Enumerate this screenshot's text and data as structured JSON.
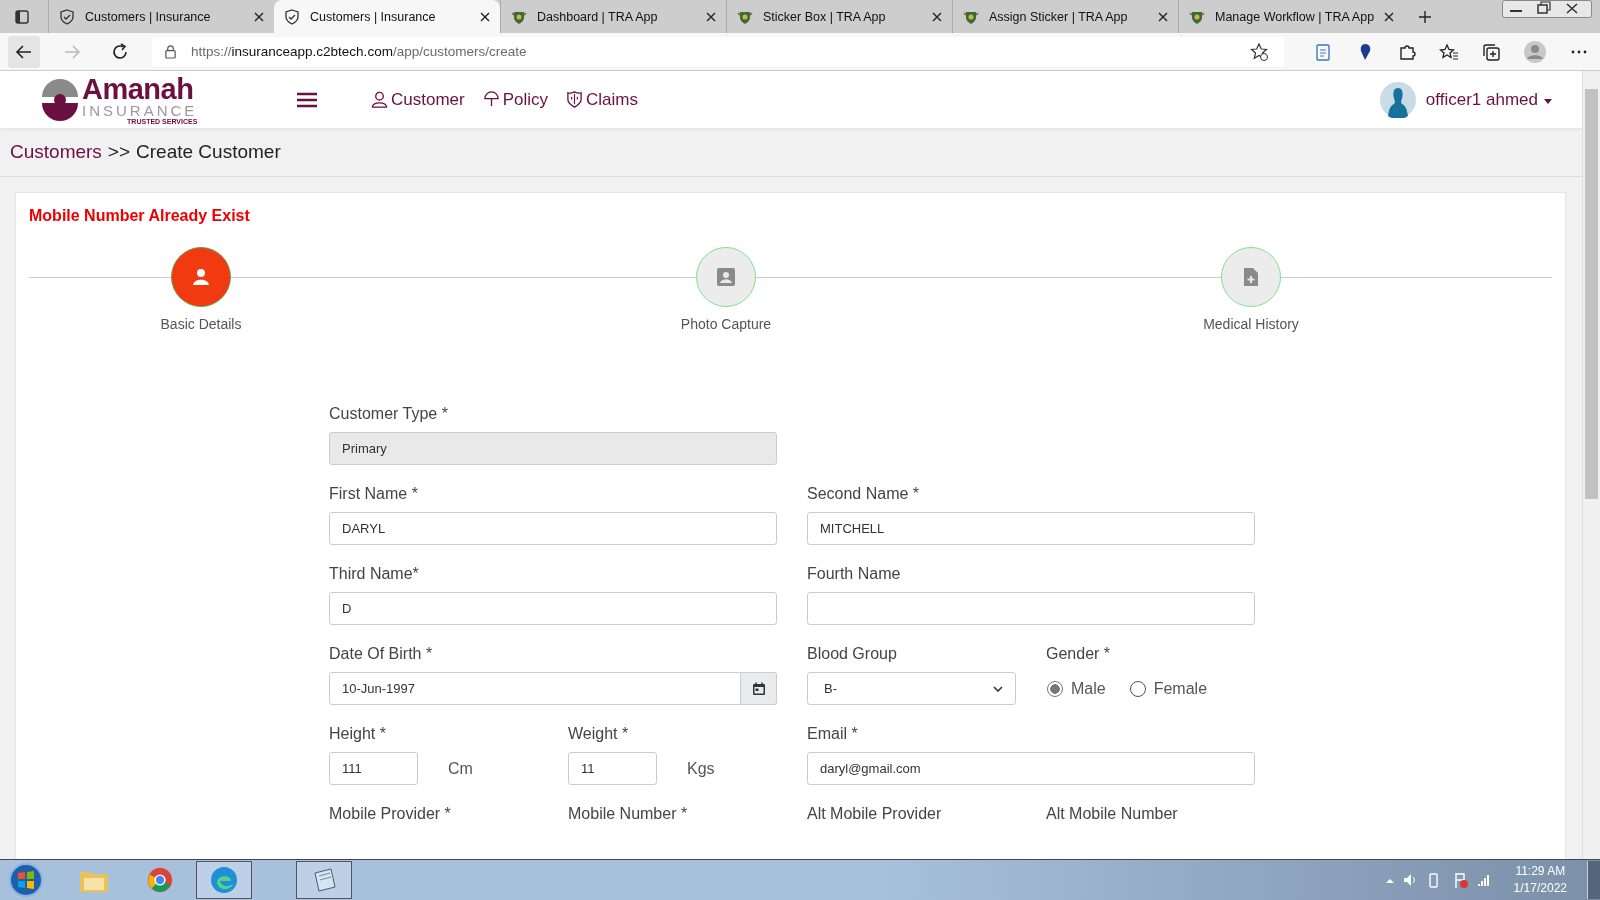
{
  "browser": {
    "tabs": [
      {
        "title": "Customers | Insurance",
        "kind": "shield",
        "selected": false
      },
      {
        "title": "Customers | Insurance",
        "kind": "shield",
        "selected": true
      },
      {
        "title": "Dashboard | TRA App",
        "kind": "crest",
        "selected": false
      },
      {
        "title": "Sticker Box | TRA App",
        "kind": "crest",
        "selected": false
      },
      {
        "title": "Assign Sticker | TRA App",
        "kind": "crest",
        "selected": false
      },
      {
        "title": "Manage Workflow | TRA App",
        "kind": "crest",
        "selected": false
      }
    ],
    "url": {
      "scheme": "https://",
      "host": "insuranceapp.c2btech.com",
      "path": "/app/customers/create"
    }
  },
  "header": {
    "logo": {
      "name": "Amanah",
      "sub": "INSURANCE",
      "tagline": "TRUSTED SERVICES"
    },
    "nav": [
      {
        "label": "Customer",
        "kind": "user"
      },
      {
        "label": "Policy",
        "kind": "umbrella"
      },
      {
        "label": "Claims",
        "kind": "shield"
      }
    ],
    "user": "officer1 ahmed"
  },
  "breadcrumb": {
    "parent": "Customers",
    "separator": ">>",
    "current": "Create Customer"
  },
  "alert": "Mobile Number Already Exist",
  "steps": [
    {
      "label": "Basic Details",
      "kind": "person",
      "selected": true
    },
    {
      "label": "Photo Capture",
      "kind": "portrait",
      "selected": false
    },
    {
      "label": "Medical History",
      "kind": "file",
      "selected": false
    }
  ],
  "form": {
    "sections": [
      {
        "left": [
          {
            "kind": "readonly",
            "label": "Customer Type *",
            "value": "Primary"
          }
        ]
      },
      {
        "left": [
          {
            "kind": "text",
            "label": "First Name *",
            "value": "DARYL"
          }
        ],
        "right": [
          {
            "kind": "text",
            "label": "Second Name *",
            "value": "MITCHELL"
          }
        ]
      },
      {
        "left": [
          {
            "kind": "text",
            "label": "Third Name*",
            "value": "D"
          }
        ],
        "right": [
          {
            "kind": "text",
            "label": "Fourth Name"
          }
        ]
      },
      {
        "left": [
          {
            "kind": "date",
            "label": "Date Of Birth *",
            "value": "10-Jun-1997"
          }
        ],
        "right": [
          {
            "kind": "select",
            "label": "Blood Group",
            "value": "B-"
          },
          {
            "kind": "radio",
            "label": "Gender *",
            "options": [
              {
                "label": "Male",
                "selected": true
              },
              {
                "label": "Female",
                "selected": false
              }
            ]
          }
        ]
      },
      {
        "left": [
          {
            "kind": "measure",
            "label": "Height *",
            "value": "111",
            "unit": "Cm"
          },
          {
            "kind": "measure",
            "label": "Weight *",
            "value": "11",
            "unit": "Kgs"
          }
        ],
        "right": [
          {
            "kind": "text",
            "label": "Email *",
            "value": "daryl@gmail.com"
          }
        ]
      },
      {
        "left": [
          {
            "kind": "heading",
            "label": "Mobile Provider *"
          },
          {
            "kind": "heading",
            "label": "Mobile Number *"
          }
        ],
        "right": [
          {
            "kind": "heading",
            "label": "Alt Mobile Provider"
          },
          {
            "kind": "heading",
            "label": "Alt Mobile Number"
          }
        ]
      }
    ]
  },
  "taskbar": {
    "time": "11:29 AM",
    "date": "1/17/2022"
  }
}
